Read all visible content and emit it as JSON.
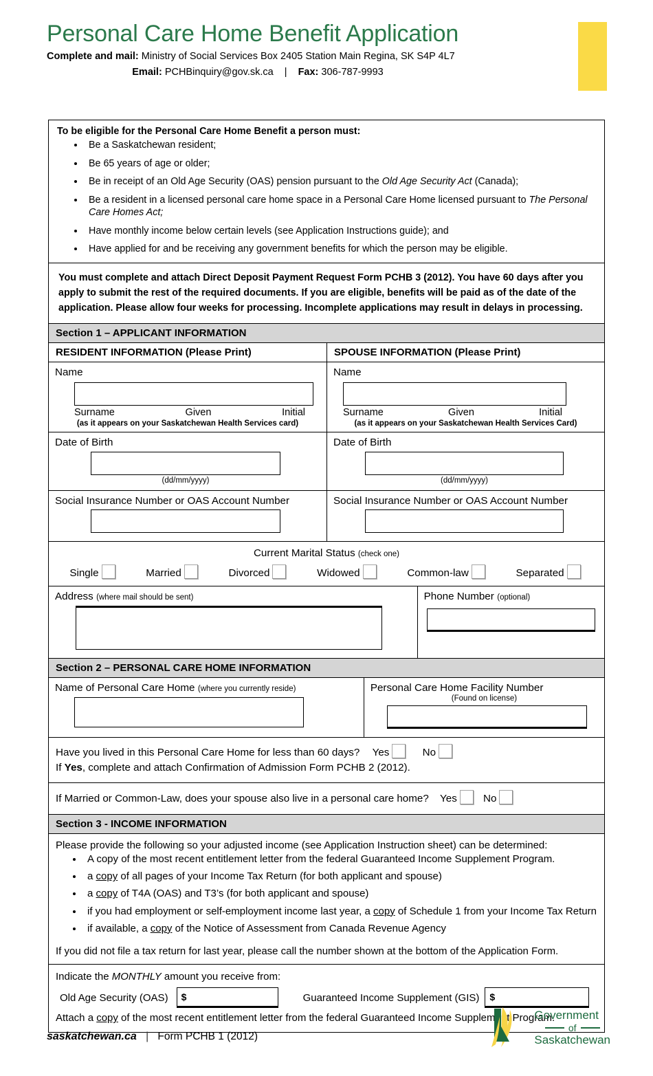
{
  "header": {
    "title": "Personal Care Home Benefit Application",
    "mail_label": "Complete and mail:",
    "mail_value": "Ministry of Social Services Box 2405 Station Main Regina, SK  S4P 4L7",
    "email_label": "Email:",
    "email_value": "PCHBinquiry@gov.sk.ca",
    "separator": "|",
    "fax_label": "Fax:",
    "fax_value": "306-787-9993",
    "accent_yellow": "#fada47",
    "accent_green": "#2b7a4b"
  },
  "eligibility": {
    "title": "To be eligible for the Personal Care Home Benefit a person must:",
    "items": [
      "Be a Saskatchewan resident;",
      "Be 65 years of age or older;",
      "Be in receipt of an Old Age Security (OAS) pension pursuant to the Old Age Security Act (Canada);",
      "Be a resident in a licensed personal care home space in a Personal Care Home licensed pursuant to The Personal Care Homes Act;",
      "Have monthly income below certain levels (see Application Instructions guide); and",
      "Have applied for and be receiving any government benefits for which the person may be eligible."
    ]
  },
  "notice": {
    "text": "You must complete and attach Direct Deposit Payment Request Form PCHB 3 (2012). You have 60 days after you apply to submit the rest of the required documents. If you are eligible, benefits will be paid as of the date of the application. Please allow four weeks for processing.  Incomplete applications may result in delays in processing."
  },
  "section1": {
    "heading": "Section 1 – APPLICANT INFORMATION",
    "resident_heading": "RESIDENT INFORMATION (Please Print)",
    "spouse_heading": "SPOUSE INFORMATION (Please Print)",
    "name_label": "Name",
    "surname_label": "Surname",
    "given_label": "Given",
    "initial_label": "Initial",
    "card_note_resident": "(as it appears on your Saskatchewan Health Services card)",
    "card_note_spouse": "(as it appears on your Saskatchewan Health Services Card)",
    "dob_label": "Date of Birth",
    "dob_format": "(dd/mm/yyyy)",
    "sin_label": "Social Insurance Number or OAS Account Number",
    "name_value": "",
    "dob_value": "",
    "sin_value": "",
    "spouse_name_value": "",
    "spouse_dob_value": "",
    "spouse_sin_value": ""
  },
  "marital": {
    "title": "Current Marital Status",
    "title_note": "(check one)",
    "options": [
      "Single",
      "Married",
      "Divorced",
      "Widowed",
      "Common-law",
      "Separated"
    ]
  },
  "address": {
    "label": "Address",
    "note": "(where mail should be sent)",
    "value": "",
    "phone_label": "Phone Number",
    "phone_note": "(optional)",
    "phone_value": ""
  },
  "section2": {
    "heading": "Section 2 – PERSONAL CARE HOME INFORMATION",
    "home_name_label": "Name of Personal Care Home",
    "home_name_note": "(where you currently reside)",
    "home_name_value": "",
    "facility_label": "Personal Care Home Facility Number",
    "facility_note": "(Found on license)",
    "facility_value": "",
    "q60_text": "Have you lived in this Personal Care Home for less than 60 days?",
    "q60_yes": "Yes",
    "q60_no": "No",
    "q60_followup_prefix": "If ",
    "q60_followup_bold": "Yes",
    "q60_followup_suffix": ", complete and attach Confirmation of Admission Form PCHB 2 (2012).",
    "q_spouse_text": "If Married or Common-Law, does your spouse also live in a personal care home?",
    "q_spouse_yes": "Yes",
    "q_spouse_no": "No"
  },
  "section3": {
    "heading": "Section 3 - INCOME INFORMATION",
    "intro": "Please provide the following so your adjusted income (see Application Instruction sheet) can be determined:",
    "items": [
      "A copy of the most recent entitlement letter from the federal Guaranteed Income Supplement Program.",
      "a copy of all pages of your Income Tax Return (for both applicant and spouse)",
      "a copy of T4A (OAS) and T3’s (for both applicant and spouse)",
      "if you had employment or self-employment income last year, a copy of Schedule 1 from your Income Tax Return",
      "if available, a copy of the Notice of Assessment from Canada Revenue Agency"
    ],
    "footnote": "If you did not file a tax return for last year, please call the number shown at the bottom of the Application Form.",
    "monthly_prefix": "Indicate the ",
    "monthly_italic": "MONTHLY",
    "monthly_suffix": " amount you receive from:",
    "oas_label": "Old Age Security (OAS)",
    "oas_currency": "$",
    "oas_value": "",
    "gis_label": "Guaranteed Income Supplement (GIS)",
    "gis_currency": "$",
    "gis_value": "",
    "attach_note": "Attach a copy of the most recent entitlement letter from the federal Guaranteed Income Supplement Program."
  },
  "footer": {
    "site": "saskatchewan.ca",
    "separator": "|",
    "form_id": "Form PCHB 1 (2012)",
    "logo_line1": "Government",
    "logo_line2": "of",
    "logo_line3": "Saskatchewan",
    "logo_green": "#1d6b3f",
    "logo_yellow": "#f7d548"
  }
}
